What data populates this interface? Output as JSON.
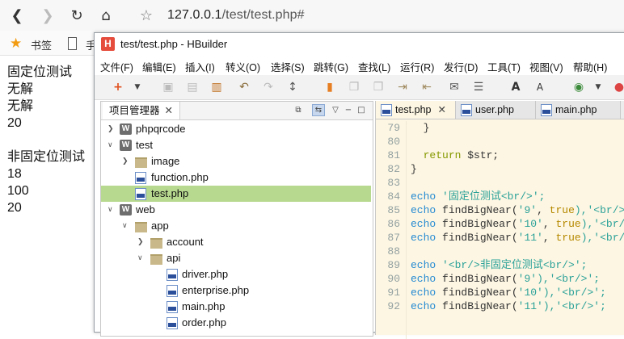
{
  "browser": {
    "back_icon": "back-arrow-icon",
    "url_host": "127.0.0.1",
    "url_path": "/test/test.php#"
  },
  "bookmarks": {
    "label": "书签",
    "next_label": "手"
  },
  "page_output": {
    "lines": [
      "固定位测试",
      "无解",
      "无解",
      "20",
      "",
      "非固定位测试",
      "18",
      "100",
      "20"
    ]
  },
  "hbuilder": {
    "logo": "H",
    "title": "test/test.php  -  HBuilder",
    "menu": [
      "文件(F)",
      "编辑(E)",
      "插入(I)",
      "转义(O)",
      "选择(S)",
      "跳转(G)",
      "查找(L)",
      "运行(R)",
      "发行(D)",
      "工具(T)",
      "视图(V)",
      "帮助(H)"
    ],
    "project_tab": "项目管理器",
    "tree": [
      {
        "label": "phpqrcode"
      },
      {
        "label": "test"
      },
      {
        "label": "image"
      },
      {
        "label": "function.php"
      },
      {
        "label": "test.php"
      },
      {
        "label": "web"
      },
      {
        "label": "app"
      },
      {
        "label": "account"
      },
      {
        "label": "api"
      },
      {
        "label": "driver.php"
      },
      {
        "label": "enterprise.php"
      },
      {
        "label": "main.php"
      },
      {
        "label": "order.php"
      }
    ],
    "editor_tabs": [
      "test.php",
      "user.php",
      "main.php"
    ],
    "code": {
      "line_numbers": [
        "79",
        "80",
        "81",
        "82",
        "83",
        "84",
        "85",
        "86",
        "87",
        "88",
        "89",
        "90",
        "91",
        "92"
      ],
      "l79": "}",
      "l81_kw": "return",
      "l81_rest": " $str;",
      "l82": "}",
      "echo": "echo",
      "l84_str": "'固定位测试<br/>';",
      "l85_fn": "findBigNear(",
      "l85_str": "'9'",
      "l85_mid": ", ",
      "l85_true": "true",
      "l85_end": "),'<br/>",
      "l86_str": "'10'",
      "l86_end": "),'<br/>",
      "l87_str": "'11'",
      "l87_end": "),'<br/>",
      "l89_str": "'<br/>非固定位测试<br/>';",
      "l90_str": "'9'",
      "l90_end": "),'<br/>';",
      "l91_str": "'10'",
      "l91_end": "),'<br/>';",
      "l92_str": "'11'",
      "l92_end": "),'<br/>';"
    }
  },
  "colors": {
    "selection": "#b7d88f",
    "editor_bg": "#fdf6e3",
    "keyword": "#859900",
    "string": "#2aa198"
  }
}
